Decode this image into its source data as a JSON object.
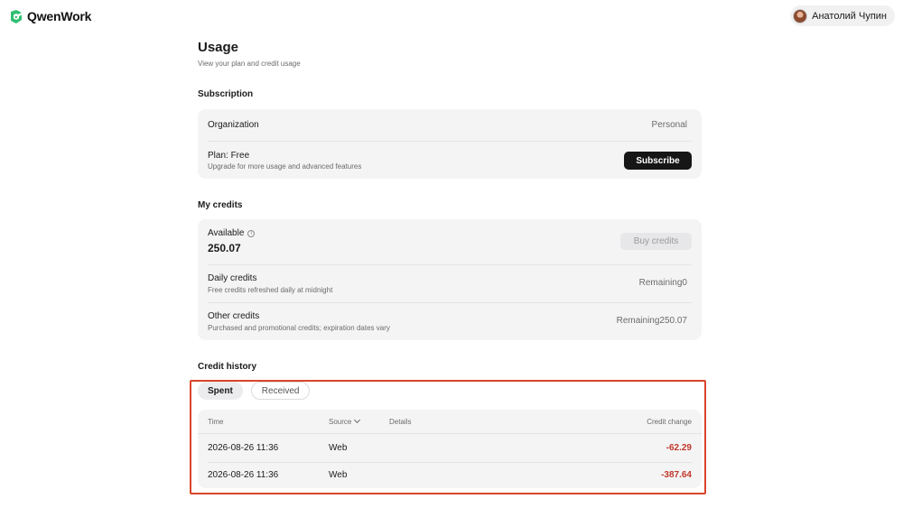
{
  "app": {
    "brand_name": "QwenWork",
    "brand_color": "#2fbf71"
  },
  "user": {
    "name": "Анатолий Чупин"
  },
  "page": {
    "title": "Usage",
    "subtitle": "View your plan and credit usage"
  },
  "subscription": {
    "section_title": "Subscription",
    "organization_label": "Organization",
    "organization_value": "Personal",
    "plan_label": "Plan: Free",
    "plan_description": "Upgrade for more usage and advanced features",
    "subscribe_button": "Subscribe"
  },
  "credits": {
    "section_title": "My credits",
    "available_label": "Available",
    "available_value": "250.07",
    "buy_button": "Buy credits",
    "daily_label": "Daily credits",
    "daily_description": "Free credits refreshed daily at midnight",
    "daily_remaining": "Remaining0",
    "other_label": "Other credits",
    "other_description": "Purchased and promotional credits; expiration dates vary",
    "other_remaining": "Remaining250.07"
  },
  "history": {
    "section_title": "Credit history",
    "tabs": [
      {
        "label": "Spent",
        "active": true
      },
      {
        "label": "Received",
        "active": false
      }
    ],
    "columns": {
      "time": "Time",
      "source": "Source",
      "details": "Details",
      "credit_change": "Credit change"
    },
    "rows": [
      {
        "time": "2026-08-26 11:36",
        "source": "Web",
        "details": "",
        "change": "-62.29"
      },
      {
        "time": "2026-08-26 11:36",
        "source": "Web",
        "details": "",
        "change": "-387.64"
      }
    ],
    "negative_color": "#c0392b",
    "highlight_color": "#d9442a"
  }
}
